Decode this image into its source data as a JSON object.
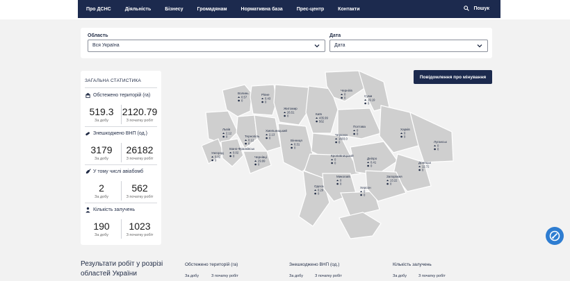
{
  "nav": {
    "items": [
      "Про ДСНС",
      "Діяльність",
      "Бізнесу",
      "Громадянам",
      "Нормативна база",
      "Прес-центр",
      "Контакти"
    ],
    "search_label": "Пошук"
  },
  "filters": {
    "region_label": "Область",
    "region_value": "Вся Україна",
    "date_label": "Дата",
    "date_value": "Дата"
  },
  "stats": {
    "title": "ЗАГАЛЬНА СТАТИСТИКА",
    "sections": [
      {
        "label": "Обстежено територій (га)",
        "icon": "area-icon",
        "day": "519.3",
        "total": "2120.79",
        "day_label": "За добу",
        "total_label": "З початку робіт"
      },
      {
        "label": "Знешкоджено ВНП (од.)",
        "icon": "ordnance-icon",
        "day": "3179",
        "total": "26182",
        "day_label": "За добу",
        "total_label": "З початку робіт"
      },
      {
        "label": "У тому числі авіабомб",
        "icon": "bomb-icon",
        "day": "2",
        "total": "562",
        "day_label": "За добу",
        "total_label": "З початку робіт"
      },
      {
        "label": "Кількість залучень",
        "icon": "personnel-icon",
        "day": "190",
        "total": "1023",
        "day_label": "За добу",
        "total_label": "З початку робіт"
      }
    ]
  },
  "report_button": "Повідомлення про мінування",
  "map": {
    "fill_color": "#cfcfcf",
    "border_color": "#ffffff",
    "regions": [
      {
        "name": "Волинь",
        "v1": "0.57",
        "v2": "0"
      },
      {
        "name": "Рівне",
        "v1": "0.43",
        "v2": "0"
      },
      {
        "name": "Житомир",
        "v1": "26.51",
        "v2": "0"
      },
      {
        "name": "Київ",
        "v1": "435.99",
        "v2": "562"
      },
      {
        "name": "Чернігів",
        "v1": "0",
        "v2": "0"
      },
      {
        "name": "Суми",
        "v1": "19.19",
        "v2": "0"
      },
      {
        "name": "Полтава",
        "v1": "0",
        "v2": "0"
      },
      {
        "name": "Харків",
        "v1": "0",
        "v2": "0"
      },
      {
        "name": "Луганськ",
        "v1": "0",
        "v2": "0"
      },
      {
        "name": "Львів",
        "v1": "2.12",
        "v2": "0"
      },
      {
        "name": "Тернопіль",
        "v1": "0.12",
        "v2": "0"
      },
      {
        "name": "Хмельницький",
        "v1": "2.13",
        "v2": "0"
      },
      {
        "name": "Вінниця",
        "v1": "0.31",
        "v2": "0"
      },
      {
        "name": "Черкаси",
        "v1": "1603.0",
        "v2": "0"
      },
      {
        "name": "Кропивницький",
        "v1": "0",
        "v2": "0"
      },
      {
        "name": "Дніпро",
        "v1": "0.41",
        "v2": "0"
      },
      {
        "name": "Донецьк",
        "v1": "12.72",
        "v2": "0"
      },
      {
        "name": "Ужгород",
        "v1": "0.02",
        "v2": "0"
      },
      {
        "name": "Івано-Франківськ",
        "v1": "0.02",
        "v2": "0"
      },
      {
        "name": "Чернівці",
        "v1": "29.99",
        "v2": "0"
      },
      {
        "name": "Одеса",
        "v1": "0.29",
        "v2": "0"
      },
      {
        "name": "Миколаїв",
        "v1": "0",
        "v2": "0"
      },
      {
        "name": "Херсон",
        "v1": "0",
        "v2": "0"
      },
      {
        "name": "Запоріжжя",
        "v1": "13.22",
        "v2": "0"
      }
    ]
  },
  "results": {
    "title": "Результати робіт у розрізі областей України",
    "columns": [
      {
        "label": "Обстежено територій (га)",
        "day": "За добу",
        "total": "З початку робіт"
      },
      {
        "label": "Знешкоджено ВНП (од.)",
        "day": "За добу",
        "total": "З початку робіт"
      },
      {
        "label": "Кількість залучень",
        "day": "За добу",
        "total": "З початку робіт"
      }
    ]
  }
}
